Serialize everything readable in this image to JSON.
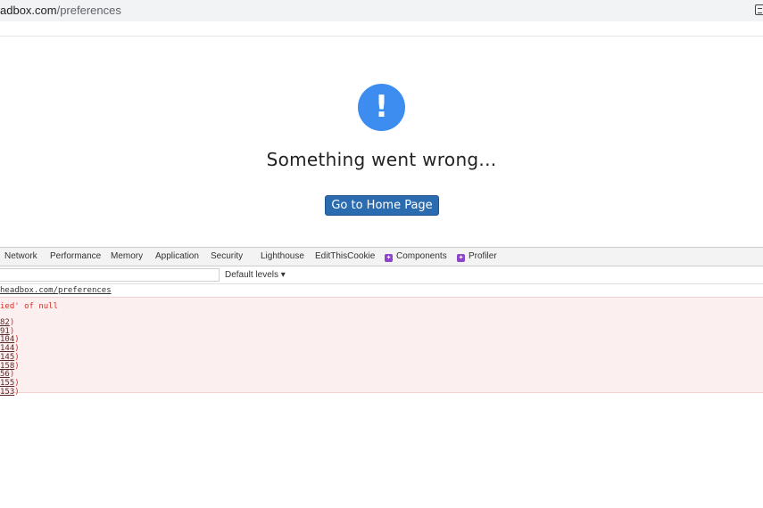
{
  "browser": {
    "url_domain": "adbox.com",
    "url_path": "/preferences",
    "extension_icon": "reader-mode-icon"
  },
  "error_page": {
    "icon": "exclamation-icon",
    "icon_glyph": "!",
    "icon_color": "#3d8cf0",
    "title": "Something went wrong...",
    "button_label": "Go to Home Page",
    "button_color": "#2b6cb0"
  },
  "devtools": {
    "tabs": [
      {
        "label": "Network"
      },
      {
        "label": "Performance"
      },
      {
        "label": "Memory"
      },
      {
        "label": "Application"
      },
      {
        "label": "Security"
      },
      {
        "label": "Lighthouse"
      },
      {
        "label": "EditThisCookie"
      },
      {
        "label": "Components",
        "icon": "react-icon"
      },
      {
        "label": "Profiler",
        "icon": "react-icon"
      }
    ],
    "toolbar": {
      "filter_value": "",
      "levels_label": "Default levels ▾"
    },
    "console": {
      "navigation": "headbox.com/preferences",
      "error_message": "ied' of null",
      "stack_links": [
        "82",
        "91",
        "104",
        "144",
        "145",
        "158",
        "56",
        "155",
        "153"
      ],
      "error_color": "#d93025"
    }
  }
}
